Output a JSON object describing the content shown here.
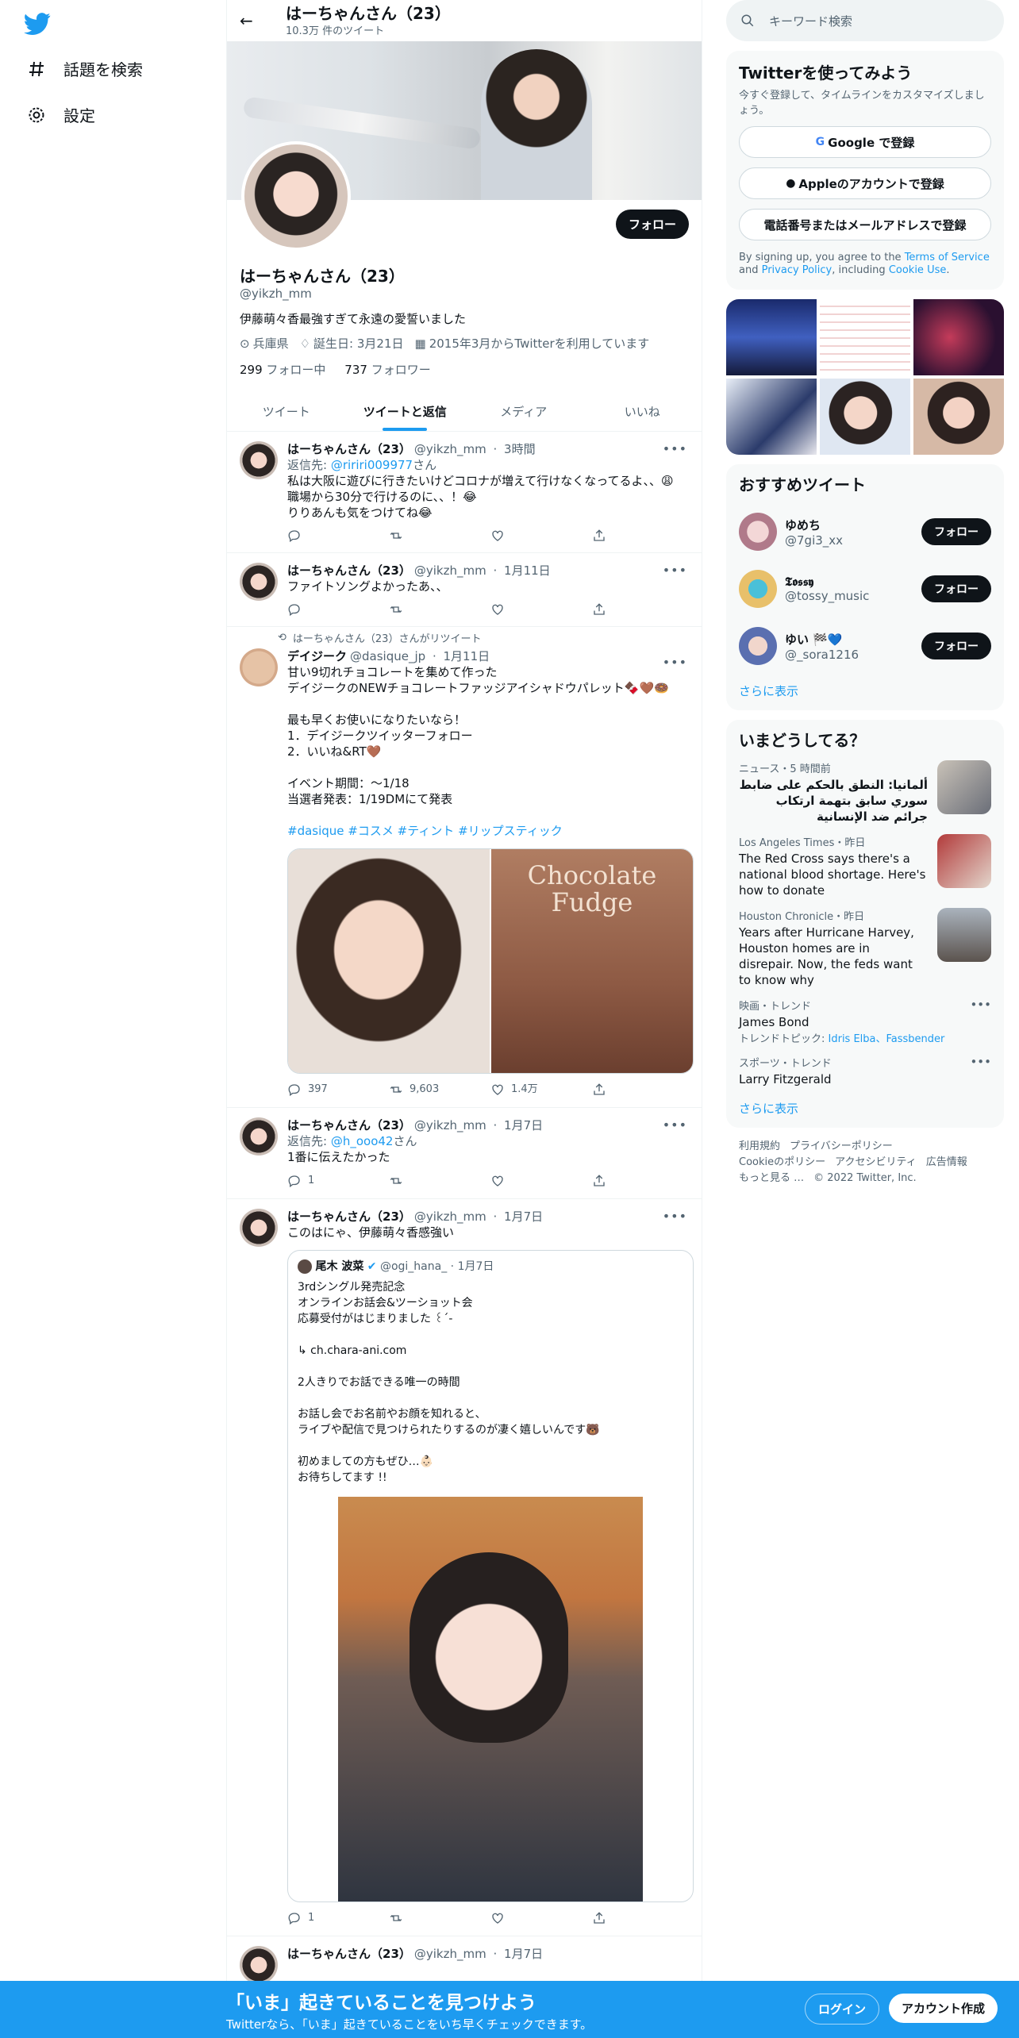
{
  "nav": {
    "explore": "話題を検索",
    "settings": "設定"
  },
  "header": {
    "name": "はーちゃんさん（23）",
    "tweet_count": "10.3万 件のツイート"
  },
  "profile": {
    "name": "はーちゃんさん（23）",
    "handle": "@yikzh_mm",
    "bio": "伊藤萌々香最強すぎて永遠の愛誓いました",
    "location": "兵庫県",
    "birthday": "誕生日: 3月21日",
    "joined": "2015年3月からTwitterを利用しています",
    "following_count": "299",
    "following_label": "フォロー中",
    "followers_count": "737",
    "followers_label": "フォロワー",
    "follow_button": "フォロー"
  },
  "tabs": [
    "ツイート",
    "ツイートと返信",
    "メディア",
    "いいね"
  ],
  "tweets": [
    {
      "name": "はーちゃんさん（23）",
      "handle": "@yikzh_mm",
      "time": "3時間",
      "reply_prefix": "返信先: ",
      "reply_to": "@ririri009977",
      "reply_suffix": "さん",
      "lines": [
        "私は大阪に遊びに行きたいけどコロナが増えて行けなくなってるよ、、😩",
        "職場から30分で行けるのに、、！😂",
        "りりあんも気をつけてね😂"
      ]
    },
    {
      "name": "はーちゃんさん（23）",
      "handle": "@yikzh_mm",
      "time": "1月11日",
      "lines": [
        "ファイトソングよかったあ、、"
      ]
    },
    {
      "rt_note": "はーちゃんさん（23）さんがリツイート",
      "name": "デイジーク",
      "handle": "@dasique_jp",
      "time": "1月11日",
      "lines": [
        "甘い9切れチョコレートを集めて作った",
        "デイジークのNEWチョコレートファッジアイシャドウパレット🍫🤎🍩",
        "",
        "最も早くお使いになりたいなら！",
        "1．デイジークツイッターフォロー",
        "2．いいね&RT🤎",
        "",
        "イベント期間：～1/18",
        "当選者発表：1/19DMにて発表"
      ],
      "hashtags": "#dasique #コスメ #ティント #リップスティック",
      "image_text_1": "Chocolate",
      "image_text_2": "Fudge",
      "replies": "397",
      "retweets": "9,603",
      "likes": "1.4万"
    },
    {
      "name": "はーちゃんさん（23）",
      "handle": "@yikzh_mm",
      "time": "1月7日",
      "reply_prefix": "返信先: ",
      "reply_to": "@h_ooo42",
      "reply_suffix": "さん",
      "lines": [
        "1番に伝えたかった"
      ],
      "replies": "1"
    },
    {
      "name": "はーちゃんさん（23）",
      "handle": "@yikzh_mm",
      "time": "1月7日",
      "lines": [
        "このはにゃ、伊藤萌々香感強い"
      ],
      "replies": "1",
      "quote": {
        "name": "尾木 波菜",
        "handle": "@ogi_hana_",
        "time": "1月7日",
        "lines": [
          "3rdシングル発売記念",
          "オンラインお話会&ツーショット会",
          "応募受付がはじまりました ꒰ˊ-",
          "",
          "↳ ch.chara-ani.com",
          "",
          "2人きりでお話できる唯一の時間",
          "",
          "お話し会でお名前やお顔を知れると、",
          "ライブや配信で見つけられたりするのが凄く嬉しいんです🐻",
          "",
          "初めましての方もぜひ…👶🏻",
          "お待ちしてます !!"
        ]
      }
    },
    {
      "name": "はーちゃんさん（23）",
      "handle": "@yikzh_mm",
      "time": "1月7日"
    }
  ],
  "right": {
    "search_placeholder": "キーワード検索",
    "signup": {
      "title": "Twitterを使ってみよう",
      "sub": "今すぐ登録して、タイムラインをカスタマイズしましょう。",
      "google": "Google で登録",
      "apple": "Appleのアカウントで登録",
      "phone": "電話番号またはメールアドレスで登録",
      "legal_1": "By signing up, you agree to the ",
      "terms": "Terms of Service",
      "legal_2": " and ",
      "privacy": "Privacy Policy",
      "legal_3": ", including ",
      "cookie": "Cookie Use",
      "legal_4": "."
    },
    "recs_title": "おすすめツイート",
    "recs": [
      {
        "name": "ゆめち",
        "handle": "@7gi3_xx",
        "button": "フォロー"
      },
      {
        "name": "𝕿𝖔𝖘𝖘𝖞",
        "handle": "@tossy_music",
        "button": "フォロー"
      },
      {
        "name": "ゆい 🏁💙",
        "handle": "@_sora1216",
        "button": "フォロー"
      }
    ],
    "show_more": "さらに表示",
    "trends_title": "いまどうしてる？",
    "trends": [
      {
        "cat": "ニュース・5 時間前",
        "title": "ألمانيا: النطق بالحكم على ضابط سوري سابق بتهمة ارتكاب جرائم ضد الإنسانية"
      },
      {
        "cat": "Los Angeles Times・昨日",
        "title": "The Red Cross says there's a national blood shortage. Here's how to donate"
      },
      {
        "cat": "Houston Chronicle・昨日",
        "title": "Years after Hurricane Harvey, Houston homes are in disrepair. Now, the feds want to know why"
      },
      {
        "cat": "映画・トレンド",
        "title": "James Bond",
        "sub_label": "トレンドトピック: ",
        "sub_links": "Idris Elba、Fassbender"
      },
      {
        "cat": "スポーツ・トレンド",
        "title": "Larry Fitzgerald"
      }
    ],
    "trends_more": "さらに表示",
    "footer": [
      "利用規約",
      "プライバシーポリシー",
      "Cookieのポリシー",
      "アクセシビリティ",
      "広告情報",
      "もっと見る …",
      "© 2022 Twitter, Inc."
    ]
  },
  "bottom": {
    "title": "「いま」起きていることを見つけよう",
    "sub": "Twitterなら、「いま」起きていることをいち早くチェックできます。",
    "login": "ログイン",
    "signup": "アカウント作成"
  },
  "colors": {
    "accent": "#1d9bf0",
    "text": "#0f1419",
    "muted": "#536471"
  }
}
